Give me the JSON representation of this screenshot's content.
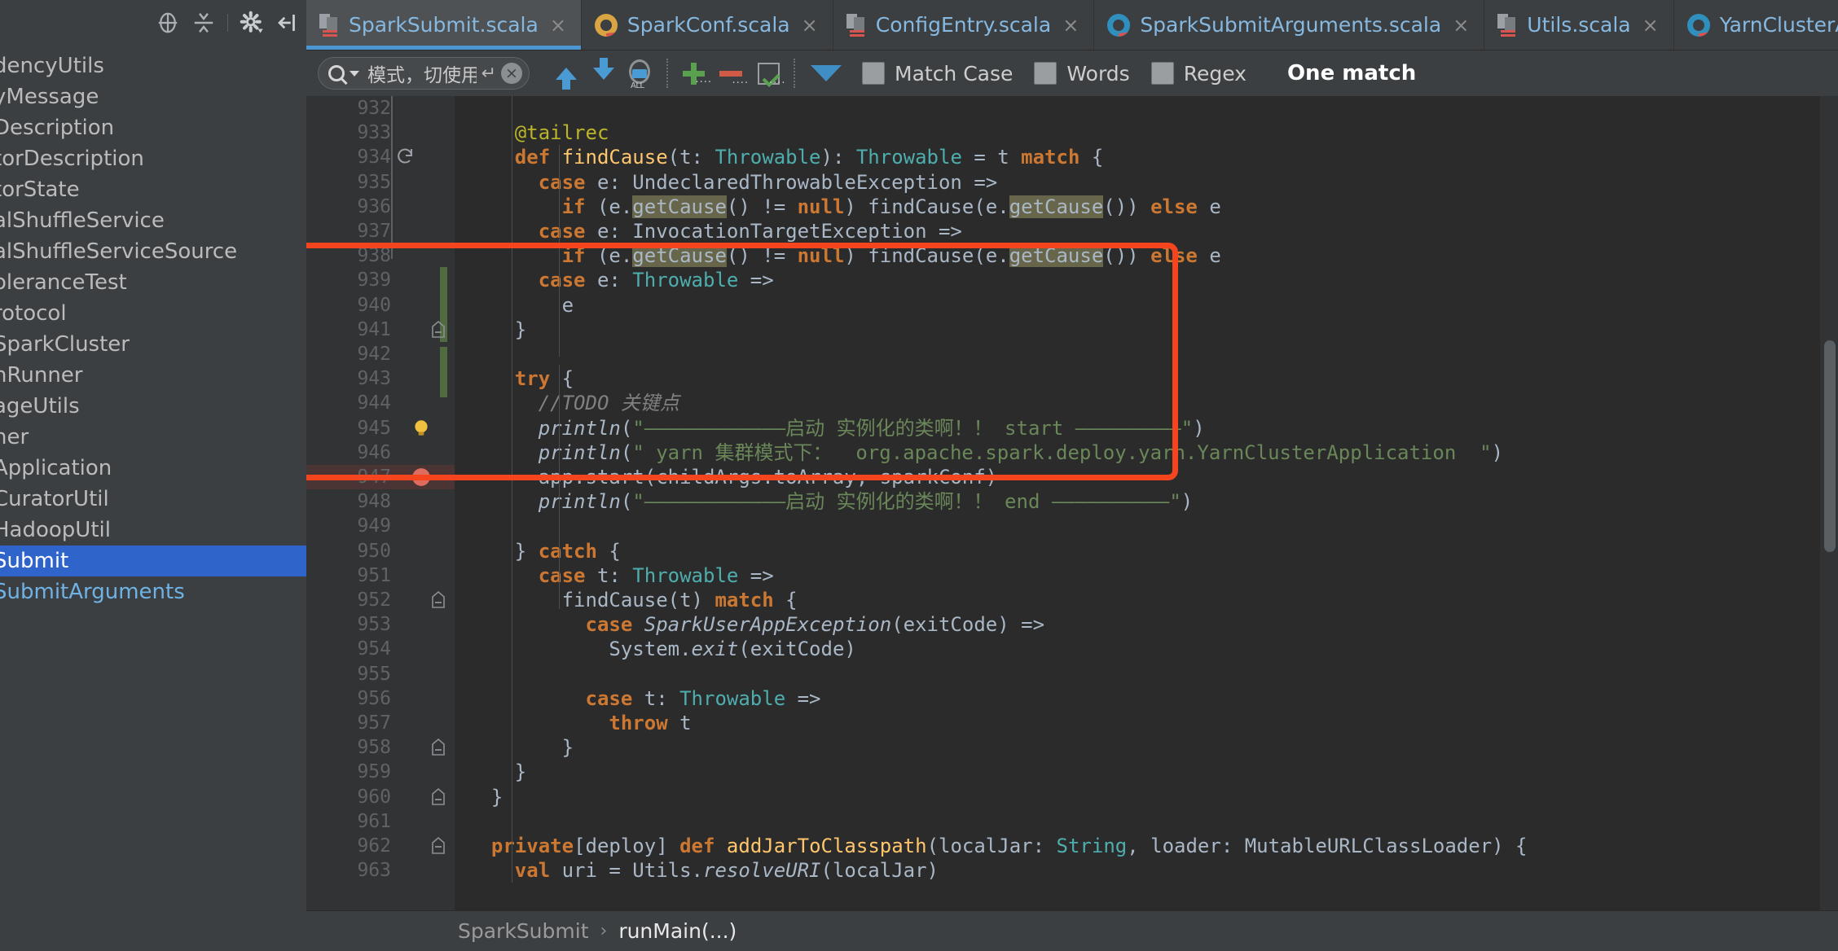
{
  "sidebar": {
    "toolbar_icons": [
      "locate-icon",
      "collapse-all-icon",
      "gear-icon",
      "hide-panel-icon"
    ],
    "items": [
      {
        "label": "dencyUtils",
        "state": "normal"
      },
      {
        "label": "yMessage",
        "state": "normal"
      },
      {
        "label": "Description",
        "state": "normal"
      },
      {
        "label": "torDescription",
        "state": "normal"
      },
      {
        "label": "torState",
        "state": "normal"
      },
      {
        "label": "alShuffleService",
        "state": "normal"
      },
      {
        "label": "alShuffleServiceSource",
        "state": "normal"
      },
      {
        "label": "oleranceTest",
        "state": "normal"
      },
      {
        "label": "rotocol",
        "state": "normal"
      },
      {
        "label": "SparkCluster",
        "state": "normal"
      },
      {
        "label": "nRunner",
        "state": "normal"
      },
      {
        "label": "ageUtils",
        "state": "normal"
      },
      {
        "label": "her",
        "state": "normal"
      },
      {
        "label": "Application",
        "state": "normal"
      },
      {
        "label": "CuratorUtil",
        "state": "normal"
      },
      {
        "label": "HadoopUtil",
        "state": "normal"
      },
      {
        "label": "Submit",
        "state": "selected"
      },
      {
        "label": "SubmitArguments",
        "state": "blue"
      }
    ]
  },
  "tabs": [
    {
      "label": "SparkSubmit.scala",
      "icon": "scala-file-icon",
      "active": true,
      "close": "×"
    },
    {
      "label": "SparkConf.scala",
      "icon": "scala-class-yellow-icon",
      "active": false,
      "close": "×"
    },
    {
      "label": "ConfigEntry.scala",
      "icon": "scala-file-icon",
      "active": false,
      "close": "×"
    },
    {
      "label": "SparkSubmitArguments.scala",
      "icon": "scala-class-teal-icon",
      "active": false,
      "close": "×"
    },
    {
      "label": "Utils.scala",
      "icon": "scala-file-icon",
      "active": false,
      "close": "×"
    },
    {
      "label": "YarnClusterApplication.class",
      "icon": "scala-class-teal-icon",
      "active": false,
      "close": "×"
    }
  ],
  "findbar": {
    "search_value": "模式，切使用",
    "search_placeholder": "模式，切使用",
    "enter_icon": "↵",
    "clear_icon": "×",
    "prev_icon": "find-previous-icon",
    "next_icon": "find-next-icon",
    "all_icon": "select-all-occurrences-icon",
    "add_icon": "add-icon",
    "remove_icon": "remove-icon",
    "select_icon": "select-icon",
    "filter_icon": "filter-icon",
    "checkboxes": [
      {
        "label": "Match Case",
        "checked": false
      },
      {
        "label": "Words",
        "checked": false
      },
      {
        "label": "Regex",
        "checked": false
      }
    ],
    "status": "One match"
  },
  "editor": {
    "first_line": 932,
    "lines": [
      {
        "n": "932",
        "segs": [],
        "gutter": null
      },
      {
        "n": "933",
        "segs": [
          {
            "t": "    ",
            "c": "plain"
          },
          {
            "t": "@tailrec",
            "c": "ann"
          }
        ],
        "gutter": null
      },
      {
        "n": "934",
        "segs": [
          {
            "t": "    ",
            "c": "plain"
          },
          {
            "t": "def",
            "c": "kw"
          },
          {
            "t": " ",
            "c": "plain"
          },
          {
            "t": "findCause",
            "c": "fn"
          },
          {
            "t": "(t: ",
            "c": "plain"
          },
          {
            "t": "Throwable",
            "c": "type"
          },
          {
            "t": "): ",
            "c": "plain"
          },
          {
            "t": "Throwable",
            "c": "type"
          },
          {
            "t": " = t ",
            "c": "plain"
          },
          {
            "t": "match",
            "c": "kw"
          },
          {
            "t": " {",
            "c": "plain"
          }
        ],
        "gutter": "recursion-icon"
      },
      {
        "n": "935",
        "segs": [
          {
            "t": "      ",
            "c": "plain"
          },
          {
            "t": "case",
            "c": "kw"
          },
          {
            "t": " e: UndeclaredThrowableException =>",
            "c": "plain"
          }
        ],
        "gutter": null
      },
      {
        "n": "936",
        "segs": [
          {
            "t": "        ",
            "c": "plain"
          },
          {
            "t": "if",
            "c": "kw"
          },
          {
            "t": " (e.",
            "c": "plain"
          },
          {
            "t": "getCause",
            "c": "hl"
          },
          {
            "t": "() != ",
            "c": "plain"
          },
          {
            "t": "null",
            "c": "kw"
          },
          {
            "t": ") findCause(e.",
            "c": "plain"
          },
          {
            "t": "getCause",
            "c": "hl"
          },
          {
            "t": "()) ",
            "c": "plain"
          },
          {
            "t": "else",
            "c": "kw"
          },
          {
            "t": " e",
            "c": "plain"
          }
        ],
        "gutter": null
      },
      {
        "n": "937",
        "segs": [
          {
            "t": "      ",
            "c": "plain"
          },
          {
            "t": "case",
            "c": "kw"
          },
          {
            "t": " e: InvocationTargetException =>",
            "c": "plain"
          }
        ],
        "gutter": null
      },
      {
        "n": "938",
        "segs": [
          {
            "t": "        ",
            "c": "plain"
          },
          {
            "t": "if",
            "c": "kw"
          },
          {
            "t": " (e.",
            "c": "plain"
          },
          {
            "t": "getCause",
            "c": "hl"
          },
          {
            "t": "() != ",
            "c": "plain"
          },
          {
            "t": "null",
            "c": "kw"
          },
          {
            "t": ") findCause(e.",
            "c": "plain"
          },
          {
            "t": "getCause",
            "c": "hl"
          },
          {
            "t": "()) ",
            "c": "plain"
          },
          {
            "t": "else",
            "c": "kw"
          },
          {
            "t": " e",
            "c": "plain"
          }
        ],
        "gutter": null
      },
      {
        "n": "939",
        "segs": [
          {
            "t": "      ",
            "c": "plain"
          },
          {
            "t": "case",
            "c": "kw"
          },
          {
            "t": " e: ",
            "c": "plain"
          },
          {
            "t": "Throwable",
            "c": "type"
          },
          {
            "t": " =>",
            "c": "plain"
          }
        ],
        "gutter": null
      },
      {
        "n": "940",
        "segs": [
          {
            "t": "        e",
            "c": "plain"
          }
        ],
        "gutter": null
      },
      {
        "n": "941",
        "segs": [
          {
            "t": "    }",
            "c": "plain"
          }
        ],
        "gutter": "fold-end-icon"
      },
      {
        "n": "942",
        "segs": [],
        "gutter": null
      },
      {
        "n": "943",
        "segs": [
          {
            "t": "    ",
            "c": "plain"
          },
          {
            "t": "try",
            "c": "kw"
          },
          {
            "t": " {",
            "c": "plain"
          }
        ],
        "gutter": null
      },
      {
        "n": "944",
        "segs": [
          {
            "t": "      ",
            "c": "plain"
          },
          {
            "t": "//TODO 关键点",
            "c": "cmt-i"
          }
        ],
        "gutter": null
      },
      {
        "n": "945",
        "segs": [
          {
            "t": "      ",
            "c": "plain"
          },
          {
            "t": "println",
            "c": "ital"
          },
          {
            "t": "(",
            "c": "plain"
          },
          {
            "t": "\"————————————启动 实例化的类啊！！ start —————————\"",
            "c": "str"
          },
          {
            "t": ")",
            "c": "plain"
          }
        ],
        "gutter": "intention-bulb-icon"
      },
      {
        "n": "946",
        "segs": [
          {
            "t": "      ",
            "c": "plain"
          },
          {
            "t": "println",
            "c": "ital"
          },
          {
            "t": "(",
            "c": "plain"
          },
          {
            "t": "\" yarn 集群模式下：  org.apache.spark.deploy.yarn.YarnClusterApplication  \"",
            "c": "str"
          },
          {
            "t": ")",
            "c": "plain"
          }
        ],
        "gutter": null
      },
      {
        "n": "947",
        "segs": [
          {
            "t": "      app.start(childArgs.toArray, sparkConf)",
            "c": "plain"
          }
        ],
        "gutter": "breakpoint-icon"
      },
      {
        "n": "948",
        "segs": [
          {
            "t": "      ",
            "c": "plain"
          },
          {
            "t": "println",
            "c": "ital"
          },
          {
            "t": "(",
            "c": "plain"
          },
          {
            "t": "\"————————————启动 实例化的类啊！！ end ——————————\"",
            "c": "str"
          },
          {
            "t": ")",
            "c": "plain"
          }
        ],
        "gutter": null
      },
      {
        "n": "949",
        "segs": [],
        "gutter": null
      },
      {
        "n": "950",
        "segs": [
          {
            "t": "    } ",
            "c": "plain"
          },
          {
            "t": "catch",
            "c": "kw"
          },
          {
            "t": " {",
            "c": "plain"
          }
        ],
        "gutter": null
      },
      {
        "n": "951",
        "segs": [
          {
            "t": "      ",
            "c": "plain"
          },
          {
            "t": "case",
            "c": "kw"
          },
          {
            "t": " t: ",
            "c": "plain"
          },
          {
            "t": "Throwable",
            "c": "type"
          },
          {
            "t": " =>",
            "c": "plain"
          }
        ],
        "gutter": null
      },
      {
        "n": "952",
        "segs": [
          {
            "t": "        findCause(t) ",
            "c": "plain"
          },
          {
            "t": "match",
            "c": "kw"
          },
          {
            "t": " {",
            "c": "plain"
          }
        ],
        "gutter": "fold-end-icon"
      },
      {
        "n": "953",
        "segs": [
          {
            "t": "          ",
            "c": "plain"
          },
          {
            "t": "case",
            "c": "kw"
          },
          {
            "t": " ",
            "c": "plain"
          },
          {
            "t": "SparkUserAppException",
            "c": "ital"
          },
          {
            "t": "(exitCode) =>",
            "c": "plain"
          }
        ],
        "gutter": null
      },
      {
        "n": "954",
        "segs": [
          {
            "t": "            System.",
            "c": "plain"
          },
          {
            "t": "exit",
            "c": "ital"
          },
          {
            "t": "(exitCode)",
            "c": "plain"
          }
        ],
        "gutter": null
      },
      {
        "n": "955",
        "segs": [],
        "gutter": null
      },
      {
        "n": "956",
        "segs": [
          {
            "t": "          ",
            "c": "plain"
          },
          {
            "t": "case",
            "c": "kw"
          },
          {
            "t": " t: ",
            "c": "plain"
          },
          {
            "t": "Throwable",
            "c": "type"
          },
          {
            "t": " =>",
            "c": "plain"
          }
        ],
        "gutter": null
      },
      {
        "n": "957",
        "segs": [
          {
            "t": "            ",
            "c": "plain"
          },
          {
            "t": "throw",
            "c": "kw"
          },
          {
            "t": " t",
            "c": "plain"
          }
        ],
        "gutter": null
      },
      {
        "n": "958",
        "segs": [
          {
            "t": "        }",
            "c": "plain"
          }
        ],
        "gutter": "fold-end-icon"
      },
      {
        "n": "959",
        "segs": [
          {
            "t": "    }",
            "c": "plain"
          }
        ],
        "gutter": null
      },
      {
        "n": "960",
        "segs": [
          {
            "t": "  }",
            "c": "plain"
          }
        ],
        "gutter": "fold-end-icon"
      },
      {
        "n": "961",
        "segs": [],
        "gutter": null
      },
      {
        "n": "962",
        "segs": [
          {
            "t": "  ",
            "c": "plain"
          },
          {
            "t": "private",
            "c": "kw"
          },
          {
            "t": "[deploy] ",
            "c": "plain"
          },
          {
            "t": "def",
            "c": "kw"
          },
          {
            "t": " ",
            "c": "plain"
          },
          {
            "t": "addJarToClasspath",
            "c": "fn"
          },
          {
            "t": "(localJar: ",
            "c": "plain"
          },
          {
            "t": "String",
            "c": "type"
          },
          {
            "t": ", loader: MutableURLClassLoader) {",
            "c": "plain"
          }
        ],
        "gutter": "fold-start-icon"
      },
      {
        "n": "963",
        "segs": [
          {
            "t": "    ",
            "c": "plain"
          },
          {
            "t": "val",
            "c": "kw"
          },
          {
            "t": " uri = Utils.",
            "c": "plain"
          },
          {
            "t": "resolveURI",
            "c": "ital"
          },
          {
            "t": "(localJar)",
            "c": "plain"
          }
        ],
        "gutter": null
      }
    ]
  },
  "annotation": {
    "shape": "rounded-rectangle",
    "color": "#f4451f",
    "covers_lines": "942-955"
  },
  "breadcrumb": {
    "items": [
      "SparkSubmit",
      "runMain(...)"
    ],
    "separator": "›"
  }
}
